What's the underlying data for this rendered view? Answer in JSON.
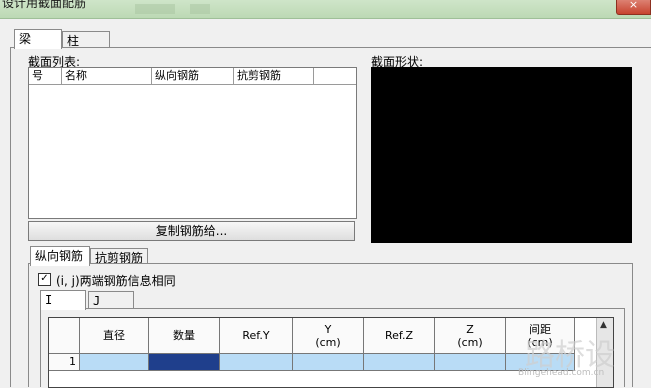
{
  "window": {
    "title": "设计用截面配筋",
    "close_glyph": "×"
  },
  "top_tabs": [
    {
      "label": "梁"
    },
    {
      "label": "柱"
    }
  ],
  "section_list": {
    "label": "截面列表:",
    "columns": [
      "号",
      "名称",
      "纵向钢筋",
      "抗剪钢筋"
    ]
  },
  "section_shape": {
    "label": "截面形状:"
  },
  "copy_button": {
    "label": "复制钢筋给..."
  },
  "sub_tabs": [
    {
      "label": "纵向钢筋"
    },
    {
      "label": "抗剪钢筋"
    }
  ],
  "same_info": {
    "checked": true,
    "check_glyph": "✓",
    "label": "(i, j)两端钢筋信息相同"
  },
  "end_tabs": [
    {
      "label": "I"
    },
    {
      "label": "J"
    }
  ],
  "rebar_grid": {
    "columns": [
      "直径",
      "数量",
      "Ref.Y",
      "Y\n(cm)",
      "Ref.Z",
      "Z\n(cm)",
      "间距\n(cm)"
    ],
    "rows": [
      {
        "index": "1"
      }
    ]
  },
  "watermark": {
    "text": "路桥设",
    "sub": "Blingehead.com.cn"
  }
}
